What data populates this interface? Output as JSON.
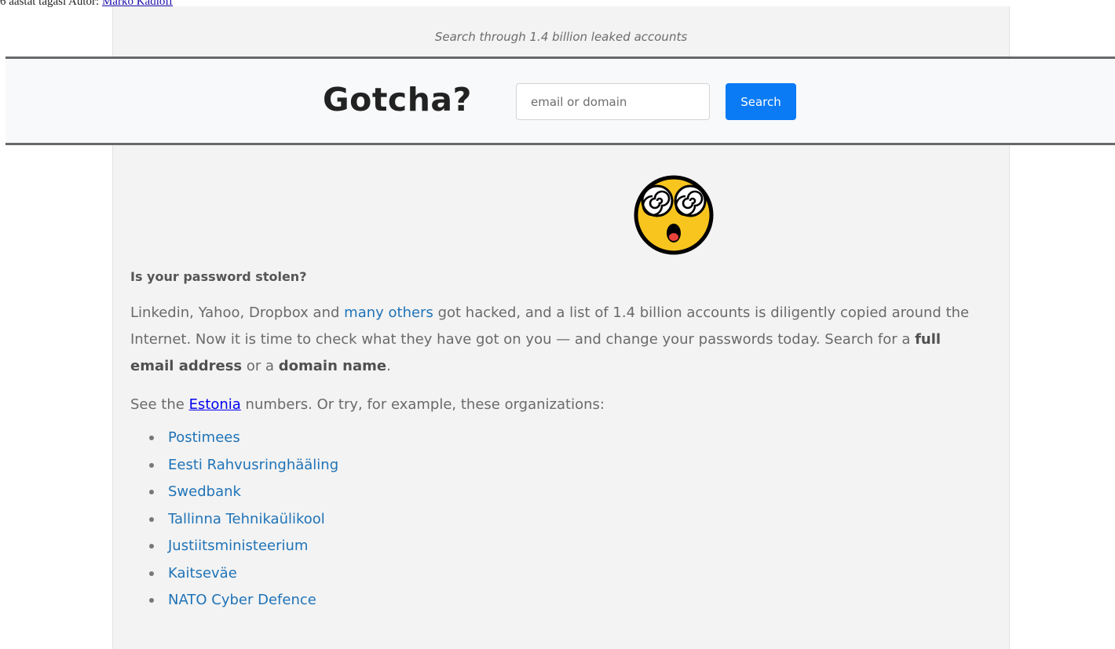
{
  "caption": {
    "text": "6 aastat tagasi Autor: ",
    "author": "Marko Kadioff"
  },
  "header": {
    "tagline": "Search through 1.4 billion leaked accounts",
    "logo": "Gotcha?",
    "search_placeholder": "email or domain",
    "search_button": "Search"
  },
  "main": {
    "question": "Is your password stolen?",
    "p1": {
      "t1": "Linkedin, Yahoo, Dropbox and ",
      "link": "many others",
      "t2": " got hacked, and a list of 1.4 billion accounts is diligently copied around the Internet. Now it is time to check what they have got on you — and change your passwords today. Search for a ",
      "b1": "full email address",
      "t3": " or a ",
      "b2": "domain name",
      "t4": "."
    },
    "p2": {
      "t1": "See the ",
      "link": "Estonia",
      "t2": " numbers. Or try, for example, these organizations:"
    },
    "organizations": [
      "Postimees",
      "Eesti Rahvusringhääling",
      "Swedbank",
      "Tallinna Tehnikaülikool",
      "Justiitsministeerium",
      "Kaitseväe",
      "NATO Cyber Defence"
    ]
  },
  "icons": {
    "hero": "dizzy-face-icon"
  },
  "colors": {
    "accent": "#0a7bf5",
    "link": "#1f73b7",
    "emoji_face": "#f7c51e"
  }
}
